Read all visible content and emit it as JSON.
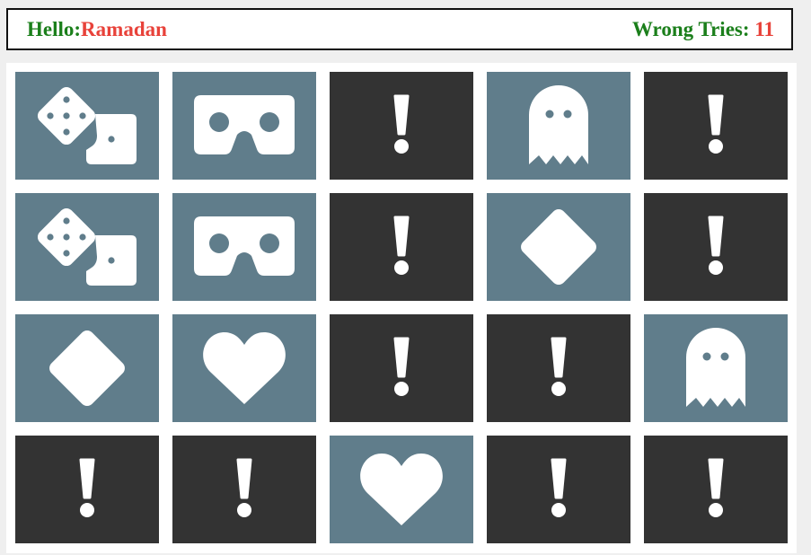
{
  "header": {
    "hello_label": "Hello:",
    "player_name": "Ramadan",
    "tries_label": "Wrong Tries:",
    "tries_count": "11"
  },
  "colors": {
    "label_green": "#1b7f1b",
    "value_red": "#e8423a",
    "card_face_down": "#333333",
    "card_face_up": "#607d8b",
    "icon_white": "#ffffff"
  },
  "board": {
    "rows": 4,
    "cols": 5,
    "cards": [
      [
        "dice-icon",
        "vr-goggles-icon",
        "hidden",
        "ghost-icon",
        "hidden"
      ],
      [
        "dice-icon",
        "vr-goggles-icon",
        "hidden",
        "diamond-icon",
        "hidden"
      ],
      [
        "diamond-icon",
        "heart-icon",
        "hidden",
        "hidden",
        "ghost-icon"
      ],
      [
        "hidden",
        "hidden",
        "heart-icon",
        "hidden",
        "hidden"
      ]
    ]
  }
}
